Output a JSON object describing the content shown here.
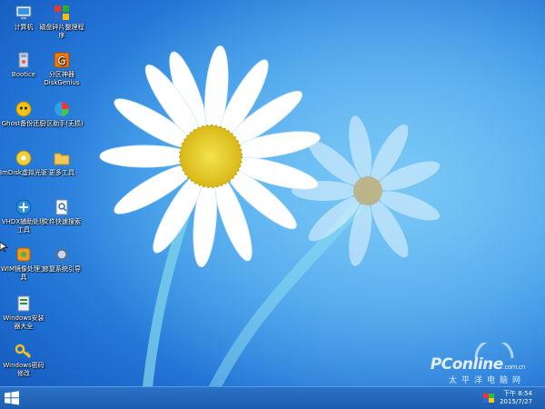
{
  "desktop_icons": [
    {
      "label": "计算机",
      "icon": "computer-icon"
    },
    {
      "label": "磁盘碎片整理程序",
      "icon": "defrag-icon"
    },
    {
      "label": "Bootice",
      "icon": "bootice-icon"
    },
    {
      "label": "分区神器DiskGenius",
      "icon": "diskgenius-icon"
    },
    {
      "label": "Ghost备份还原",
      "icon": "ghost-icon"
    },
    {
      "label": "分区助手(无损)",
      "icon": "partition-assistant-icon"
    },
    {
      "label": "ImDisk虚拟光驱",
      "icon": "imdisk-icon"
    },
    {
      "label": "更多工具",
      "icon": "folder-icon"
    },
    {
      "label": "VHDX辅助处理工具",
      "icon": "vhdx-icon"
    },
    {
      "label": "文件快速搜索",
      "icon": "file-search-icon"
    },
    {
      "label": "WIM镜像处理工具",
      "icon": "wim-icon"
    },
    {
      "label": "修复系统引导",
      "icon": "repair-boot-icon"
    },
    {
      "label": "Windows安装器大全",
      "icon": "windows-installer-icon"
    },
    {
      "label": "Windows密码修改",
      "icon": "password-key-icon"
    }
  ],
  "watermark": {
    "brand": "PConline",
    "domain": ".com.cn",
    "subtitle": "太平洋电脑网"
  },
  "taskbar": {
    "start_icon": "windows-start-icon",
    "clock_time": "下午 8:54",
    "clock_date": "2015/7/27"
  },
  "colors": {
    "taskbar": "#1d5eb0",
    "sky": "#3a96e6"
  }
}
